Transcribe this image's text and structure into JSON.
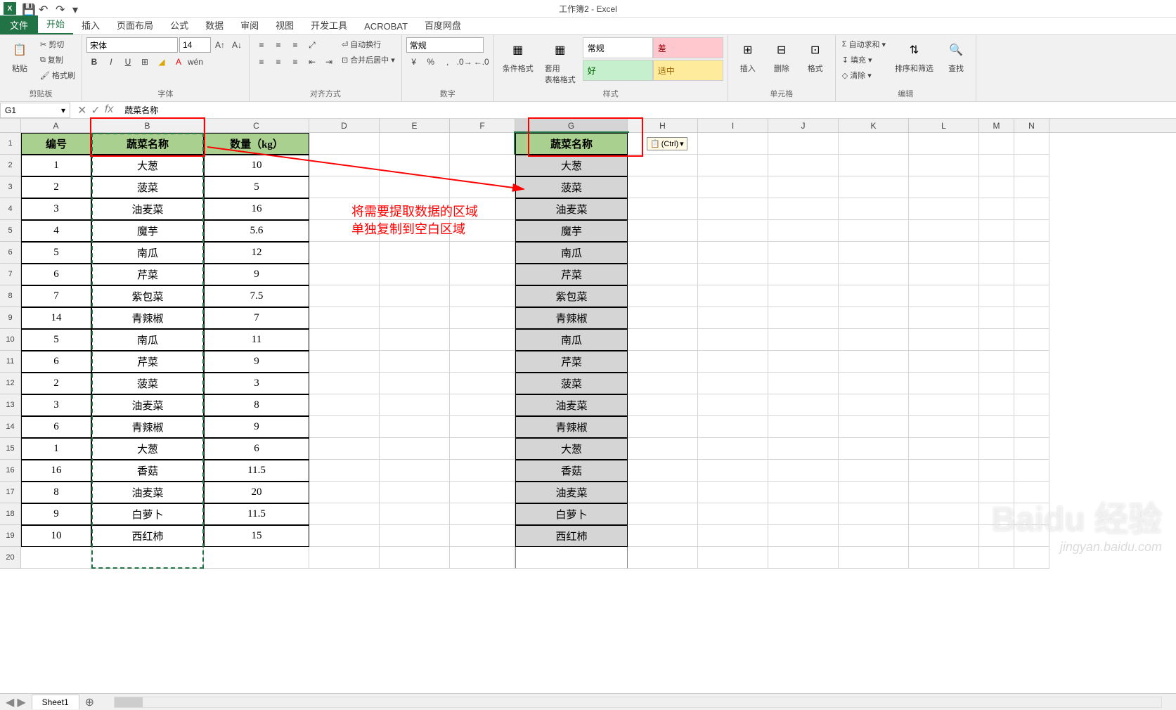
{
  "app": {
    "title": "工作簿2 - Excel"
  },
  "tabs": {
    "file": "文件",
    "home": "开始",
    "insert": "插入",
    "page_layout": "页面布局",
    "formulas": "公式",
    "data": "数据",
    "review": "审阅",
    "view": "视图",
    "dev": "开发工具",
    "acrobat": "ACROBAT",
    "baidu": "百度网盘"
  },
  "ribbon": {
    "clipboard": {
      "label": "剪贴板",
      "paste": "粘贴",
      "cut": "剪切",
      "copy": "复制",
      "format_painter": "格式刷"
    },
    "font": {
      "label": "字体",
      "name": "宋体",
      "size": "14"
    },
    "align": {
      "label": "对齐方式",
      "wrap": "自动换行",
      "merge": "合并后居中"
    },
    "number": {
      "label": "数字",
      "format": "常规"
    },
    "styles": {
      "label": "样式",
      "cond_fmt": "条件格式",
      "as_table": "套用\n表格格式",
      "normal": "常规",
      "bad": "差",
      "good": "好",
      "neutral": "适中"
    },
    "cells": {
      "label": "单元格",
      "insert": "插入",
      "delete": "删除",
      "format": "格式"
    },
    "editing": {
      "label": "编辑",
      "autosum": "自动求和",
      "fill": "填充",
      "clear": "清除",
      "sort": "排序和筛选",
      "find": "查找"
    }
  },
  "formula_bar": {
    "name_box": "G1",
    "formula": "蔬菜名称"
  },
  "columns": [
    "A",
    "B",
    "C",
    "D",
    "E",
    "F",
    "G",
    "H",
    "I",
    "J",
    "K",
    "L",
    "M",
    "N"
  ],
  "table": {
    "headers": {
      "id": "编号",
      "name": "蔬菜名称",
      "qty": "数量（kg）"
    },
    "rows": [
      {
        "id": "1",
        "name": "大葱",
        "qty": "10"
      },
      {
        "id": "2",
        "name": "菠菜",
        "qty": "5"
      },
      {
        "id": "3",
        "name": "油麦菜",
        "qty": "16"
      },
      {
        "id": "4",
        "name": "魔芋",
        "qty": "5.6"
      },
      {
        "id": "5",
        "name": "南瓜",
        "qty": "12"
      },
      {
        "id": "6",
        "name": "芹菜",
        "qty": "9"
      },
      {
        "id": "7",
        "name": "紫包菜",
        "qty": "7.5"
      },
      {
        "id": "14",
        "name": "青辣椒",
        "qty": "7"
      },
      {
        "id": "5",
        "name": "南瓜",
        "qty": "11"
      },
      {
        "id": "6",
        "name": "芹菜",
        "qty": "9"
      },
      {
        "id": "2",
        "name": "菠菜",
        "qty": "3"
      },
      {
        "id": "3",
        "name": "油麦菜",
        "qty": "8"
      },
      {
        "id": "6",
        "name": "青辣椒",
        "qty": "9"
      },
      {
        "id": "1",
        "name": "大葱",
        "qty": "6"
      },
      {
        "id": "16",
        "name": "香菇",
        "qty": "11.5"
      },
      {
        "id": "8",
        "name": "油麦菜",
        "qty": "20"
      },
      {
        "id": "9",
        "name": "白萝卜",
        "qty": "11.5"
      },
      {
        "id": "10",
        "name": "西红柿",
        "qty": "15"
      }
    ]
  },
  "annotation": {
    "line1": "将需要提取数据的区域",
    "line2": "单独复制到空白区域"
  },
  "paste_options": "(Ctrl)",
  "sheet": {
    "name": "Sheet1"
  },
  "watermark": {
    "logo": "Baidu 经验",
    "url": "jingyan.baidu.com"
  }
}
